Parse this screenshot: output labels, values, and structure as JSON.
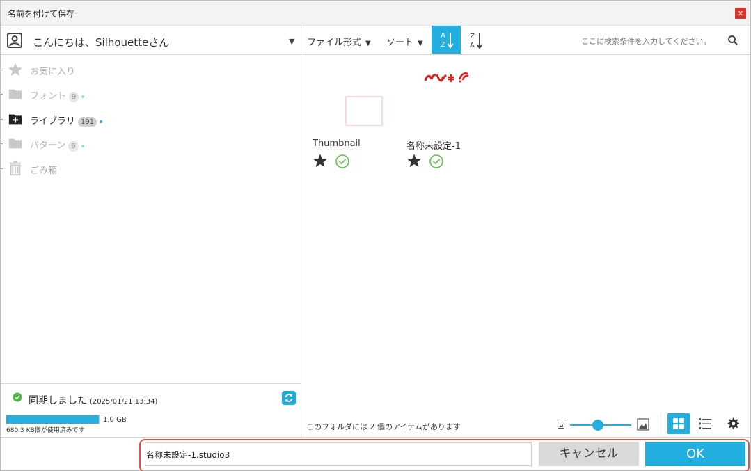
{
  "window": {
    "title": "名前を付けて保存",
    "close_label": "x"
  },
  "user": {
    "greeting": "こんにちは、Silhouetteさん",
    "dropdown_arrow": "▼",
    "icon": "user-icon"
  },
  "tree": {
    "items": [
      {
        "label": "お気に入り",
        "count": "",
        "icon": "star-icon",
        "active": false
      },
      {
        "label": "フォント",
        "count": "9",
        "icon": "folder-icon",
        "active": false
      },
      {
        "label": "ライブラリ",
        "count": "191",
        "icon": "folder-add-icon",
        "active": true
      },
      {
        "label": "パターン",
        "count": "9",
        "icon": "folder-icon",
        "active": false
      },
      {
        "label": "ごみ箱",
        "count": "",
        "icon": "trash-icon",
        "active": false
      }
    ]
  },
  "sync": {
    "status": "同期しました",
    "timestamp": "(2025/01/21 13:34)",
    "storage_total": "1.0 GB",
    "storage_used": "680.3 KB個が使用済みです",
    "storage_fraction": 0.99
  },
  "toolbar": {
    "file_type_label": "ファイル形式",
    "sort_label": "ソート",
    "dropdown_arrow": "▼",
    "search_placeholder": "ここに検索条件を入力してください。"
  },
  "thumbnails": [
    {
      "label": "Thumbnail"
    },
    {
      "label": "名称未設定-1"
    }
  ],
  "footer": {
    "item_count": "このフォルダには 2 個のアイテムがあります",
    "zoom_level": 0.45
  },
  "save_bar": {
    "filename": "名称未設定-1.studio3",
    "cancel_label": "キャンセル",
    "ok_label": "OK"
  },
  "colors": {
    "accent": "#23aee0",
    "close": "#d9342b",
    "highlight": "#e05540",
    "sync_ok": "#4cb848"
  }
}
